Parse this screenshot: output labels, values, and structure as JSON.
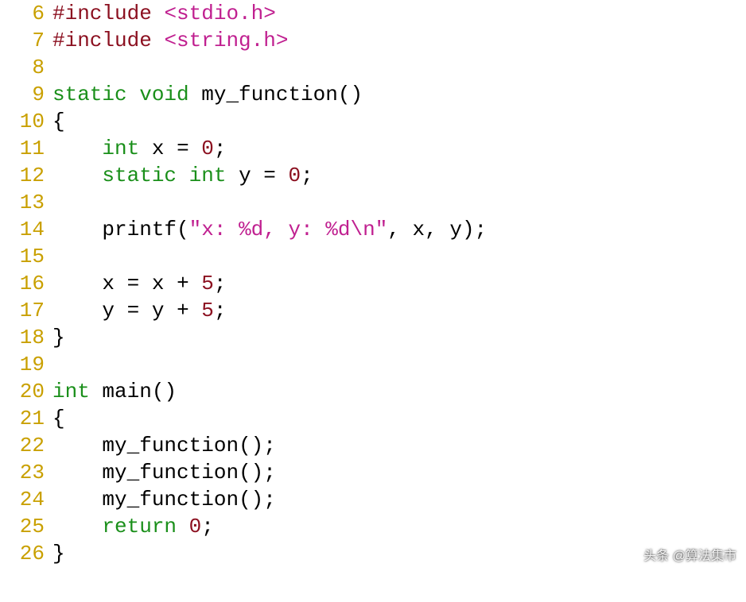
{
  "watermark": "头条 @算法集市",
  "lines": [
    {
      "n": 6,
      "tokens": [
        [
          "pp",
          "#include "
        ],
        [
          "sys",
          "<stdio.h>"
        ]
      ]
    },
    {
      "n": 7,
      "tokens": [
        [
          "pp",
          "#include "
        ],
        [
          "sys",
          "<string.h>"
        ]
      ]
    },
    {
      "n": 8,
      "tokens": []
    },
    {
      "n": 9,
      "tokens": [
        [
          "kw",
          "static "
        ],
        [
          "kw",
          "void "
        ],
        [
          "fn",
          "my_function"
        ],
        [
          "pun",
          "()"
        ]
      ]
    },
    {
      "n": 10,
      "tokens": [
        [
          "pun",
          "{"
        ]
      ]
    },
    {
      "n": 11,
      "tokens": [
        [
          "id",
          "    "
        ],
        [
          "kw",
          "int "
        ],
        [
          "id",
          "x "
        ],
        [
          "op",
          "= "
        ],
        [
          "num",
          "0"
        ],
        [
          "pun",
          ";"
        ]
      ]
    },
    {
      "n": 12,
      "tokens": [
        [
          "id",
          "    "
        ],
        [
          "kw",
          "static "
        ],
        [
          "kw",
          "int "
        ],
        [
          "id",
          "y "
        ],
        [
          "op",
          "= "
        ],
        [
          "num",
          "0"
        ],
        [
          "pun",
          ";"
        ]
      ]
    },
    {
      "n": 13,
      "tokens": []
    },
    {
      "n": 14,
      "tokens": [
        [
          "id",
          "    "
        ],
        [
          "fn",
          "printf"
        ],
        [
          "pun",
          "("
        ],
        [
          "str",
          "\"x: %d, y: %d\\n\""
        ],
        [
          "pun",
          ", "
        ],
        [
          "id",
          "x"
        ],
        [
          "pun",
          ", "
        ],
        [
          "id",
          "y"
        ],
        [
          "pun",
          ");"
        ]
      ]
    },
    {
      "n": 15,
      "tokens": []
    },
    {
      "n": 16,
      "tokens": [
        [
          "id",
          "    x "
        ],
        [
          "op",
          "= "
        ],
        [
          "id",
          "x "
        ],
        [
          "op",
          "+ "
        ],
        [
          "num",
          "5"
        ],
        [
          "pun",
          ";"
        ]
      ]
    },
    {
      "n": 17,
      "tokens": [
        [
          "id",
          "    y "
        ],
        [
          "op",
          "= "
        ],
        [
          "id",
          "y "
        ],
        [
          "op",
          "+ "
        ],
        [
          "num",
          "5"
        ],
        [
          "pun",
          ";"
        ]
      ]
    },
    {
      "n": 18,
      "tokens": [
        [
          "pun",
          "}"
        ]
      ]
    },
    {
      "n": 19,
      "tokens": []
    },
    {
      "n": 20,
      "tokens": [
        [
          "kw",
          "int "
        ],
        [
          "fn",
          "main"
        ],
        [
          "pun",
          "()"
        ]
      ]
    },
    {
      "n": 21,
      "tokens": [
        [
          "pun",
          "{"
        ]
      ]
    },
    {
      "n": 22,
      "tokens": [
        [
          "id",
          "    "
        ],
        [
          "fn",
          "my_function"
        ],
        [
          "pun",
          "();"
        ]
      ]
    },
    {
      "n": 23,
      "tokens": [
        [
          "id",
          "    "
        ],
        [
          "fn",
          "my_function"
        ],
        [
          "pun",
          "();"
        ]
      ]
    },
    {
      "n": 24,
      "tokens": [
        [
          "id",
          "    "
        ],
        [
          "fn",
          "my_function"
        ],
        [
          "pun",
          "();"
        ]
      ]
    },
    {
      "n": 25,
      "tokens": [
        [
          "id",
          "    "
        ],
        [
          "kw",
          "return "
        ],
        [
          "num",
          "0"
        ],
        [
          "pun",
          ";"
        ]
      ]
    },
    {
      "n": 26,
      "tokens": [
        [
          "pun",
          "}"
        ]
      ]
    }
  ]
}
